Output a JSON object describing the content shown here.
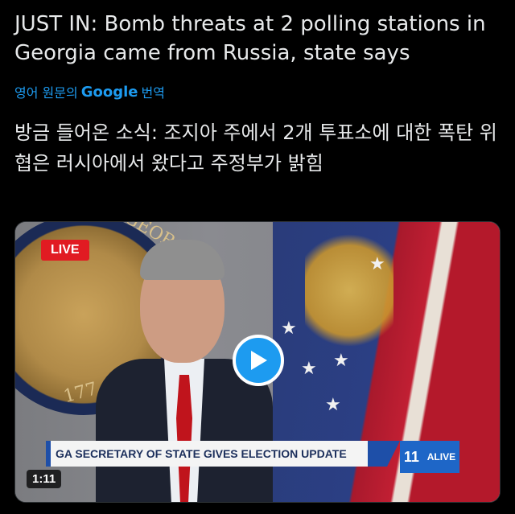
{
  "post": {
    "text": "JUST IN: Bomb threats at 2 polling stations in Georgia came from Russia, state says",
    "translate_prefix": "영어 원문의",
    "translate_brand": "Google",
    "translate_suffix": "번역",
    "translated_text": "방금 들어온 소식: 조지아 주에서 2개 투표소에 대한 폭탄 위협은 러시아에서 왔다고 주정부가 밝힘"
  },
  "video": {
    "live_label": "LIVE",
    "lower_third": "GA SECRETARY OF STATE GIVES ELECTION UPDATE",
    "station_number": "11",
    "station_name": "ALIVE",
    "duration": "1:11",
    "seal_text": "GEORGIA",
    "seal_year": "177",
    "play_icon": "play-icon",
    "accent_color": "#1d9bf0",
    "live_color": "#e11b22"
  }
}
